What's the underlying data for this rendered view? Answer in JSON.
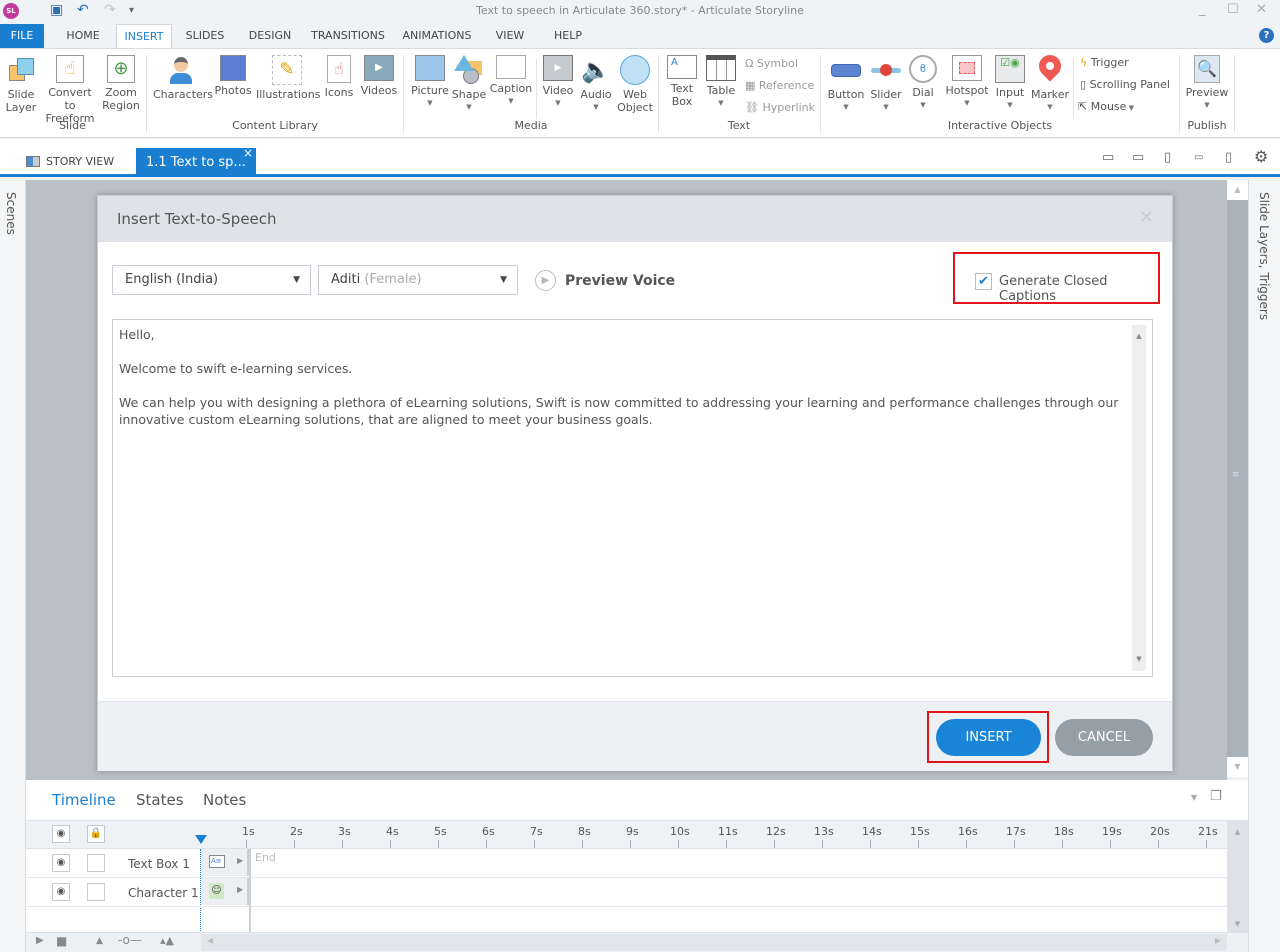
{
  "window": {
    "title": "Text to speech in Articulate 360.story* -  Articulate Storyline",
    "app_logo": "SL",
    "controls": {
      "minimize": "_",
      "maximize": "☐",
      "close": "✕"
    }
  },
  "quick_access": {
    "save_icon": "💾",
    "undo_icon": "↶",
    "redo_icon": "↷",
    "customize_icon": "▾"
  },
  "ribbon_tabs": [
    {
      "label": "FILE"
    },
    {
      "label": "HOME"
    },
    {
      "label": "INSERT"
    },
    {
      "label": "SLIDES"
    },
    {
      "label": "DESIGN"
    },
    {
      "label": "TRANSITIONS"
    },
    {
      "label": "ANIMATIONS"
    },
    {
      "label": "VIEW"
    },
    {
      "label": "HELP"
    }
  ],
  "active_ribbon_tab": "INSERT",
  "help_icon": "?",
  "ribbon": {
    "groups": {
      "slide": "Slide",
      "content_library": "Content Library",
      "media": "Media",
      "text": "Text",
      "interactive": "Interactive Objects",
      "publish": "Publish"
    },
    "buttons": {
      "slide_layer": [
        "Slide",
        "Layer"
      ],
      "convert_freeform": [
        "Convert to",
        "Freeform"
      ],
      "zoom_region": [
        "Zoom",
        "Region"
      ],
      "characters": "Characters",
      "photos": "Photos",
      "illustrations": "Illustrations",
      "icons": "Icons",
      "videos": "Videos",
      "picture": "Picture",
      "shape": "Shape",
      "caption": "Caption",
      "video": "Video",
      "audio": "Audio",
      "web_object": [
        "Web",
        "Object"
      ],
      "text_box": [
        "Text",
        "Box"
      ],
      "table": "Table",
      "symbol": "Symbol",
      "reference": "Reference",
      "hyperlink": "Hyperlink",
      "button": "Button",
      "slider": "Slider",
      "dial": "Dial",
      "hotspot": "Hotspot",
      "input": "Input",
      "marker": "Marker",
      "trigger": "Trigger",
      "scrolling_panel": "Scrolling Panel",
      "mouse": "Mouse",
      "preview": "Preview"
    }
  },
  "view_tabs": {
    "story_view": "STORY VIEW",
    "slide_tab": "1.1 Text to sp...",
    "close": "×"
  },
  "side_panels": {
    "left": "Scenes",
    "right": "Slide Layers, Triggers"
  },
  "dialog": {
    "title": "Insert Text-to-Speech",
    "close": "×",
    "language": "English (India)",
    "voice_name": "Aditi",
    "voice_gender": "(Female)",
    "preview_voice": "Preview Voice",
    "generate_cc_label": "Generate Closed Captions",
    "generate_cc_checked": true,
    "text_paragraphs": [
      "Hello,",
      "Welcome to swift e-learning services.",
      "We can help you with designing a plethora of eLearning solutions, Swift is now committed to addressing your learning and performance challenges through our innovative custom eLearning solutions, that are aligned to meet your business goals."
    ],
    "insert_label": "INSERT",
    "cancel_label": "CANCEL"
  },
  "timeline": {
    "tabs": [
      "Timeline",
      "States",
      "Notes"
    ],
    "active_tab": "Timeline",
    "ticks": [
      "1s",
      "2s",
      "3s",
      "4s",
      "5s",
      "6s",
      "7s",
      "8s",
      "9s",
      "10s",
      "11s",
      "12s",
      "13s",
      "14s",
      "15s",
      "16s",
      "17s",
      "18s",
      "19s",
      "20s",
      "21s"
    ],
    "end_label": "End",
    "rows": [
      {
        "name": "Text Box 1",
        "type": "text-box"
      },
      {
        "name": "Character 1",
        "type": "character"
      }
    ]
  },
  "colors": {
    "accent": "#1a7fd1",
    "highlight": "#e2141a",
    "cancel": "#959fa7"
  }
}
